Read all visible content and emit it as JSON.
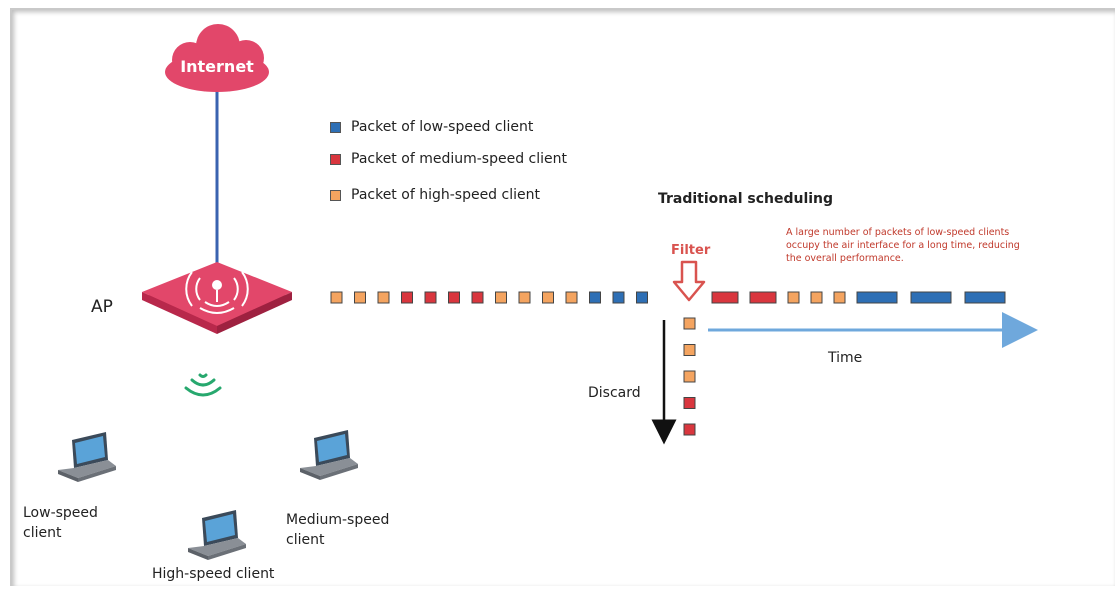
{
  "internet_label": "Internet",
  "ap_label": "AP",
  "legend": [
    {
      "label": "Packet of low-speed client",
      "color": "#2e6fb5"
    },
    {
      "label": "Packet of medium-speed client",
      "color": "#d9363e"
    },
    {
      "label": "Packet of high-speed client",
      "color": "#f4a460"
    }
  ],
  "scheduling_title": "Traditional scheduling",
  "filter_label": "Filter",
  "note_text": "A large number of packets of low-speed clients occupy the air interface for a long time, reducing the overall performance.",
  "time_label": "Time",
  "discard_label": "Discard",
  "clients": {
    "low": "Low-speed client",
    "medium": "Medium-speed client",
    "high": "High-speed client"
  },
  "colors": {
    "low": "#2e6fb5",
    "medium": "#d9363e",
    "high": "#f4a460",
    "cloud": "#e2476a",
    "ap": "#e2476a",
    "link": "#3a63b0",
    "time_arrow": "#6fa8dc",
    "wifi": "#27a86e",
    "note": "#c0392b"
  },
  "queue_before_filter": [
    "high",
    "high",
    "high",
    "medium",
    "medium",
    "medium",
    "medium",
    "high",
    "high",
    "high",
    "high",
    "low",
    "low",
    "low"
  ],
  "queue_after_filter": [
    "medium",
    "medium",
    "high",
    "high",
    "high",
    "low",
    "low",
    "low"
  ],
  "discarded": [
    "high",
    "high",
    "high",
    "medium",
    "medium"
  ]
}
